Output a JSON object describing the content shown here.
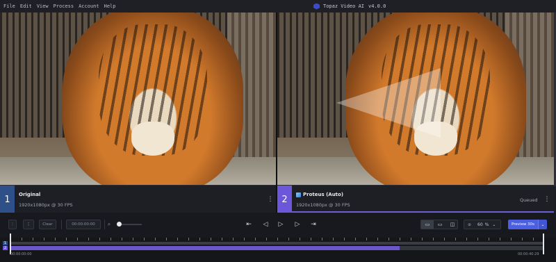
{
  "menu": [
    "File",
    "Edit",
    "View",
    "Process",
    "Account",
    "Help"
  ],
  "app": {
    "title": "Topaz Video AI",
    "version": "v4.0.0"
  },
  "left_panel": {
    "index": "1",
    "title": "Original",
    "subtitle": "1920x1080px @ 30 FPS"
  },
  "right_panel": {
    "index": "2",
    "title": "Proteus (Auto)",
    "subtitle": "1920x1080px @ 30 FPS",
    "status": "Queued"
  },
  "toolbar": {
    "clear_label": "Clear",
    "timecode": "00:00:00:00",
    "zoom_value": "60",
    "zoom_unit": "%",
    "preview_label": "Preview 30s"
  },
  "timeline": {
    "track_labels": [
      "1",
      "2"
    ],
    "start_time": "00:00:00:00",
    "end_time": "00:00:40:29",
    "processed_fraction": 0.73
  },
  "colors": {
    "accent": "#4c5fe0",
    "track_fill": "#6c56c9",
    "original_badge": "#2f4f89",
    "model_badge": "#6c56d9"
  }
}
